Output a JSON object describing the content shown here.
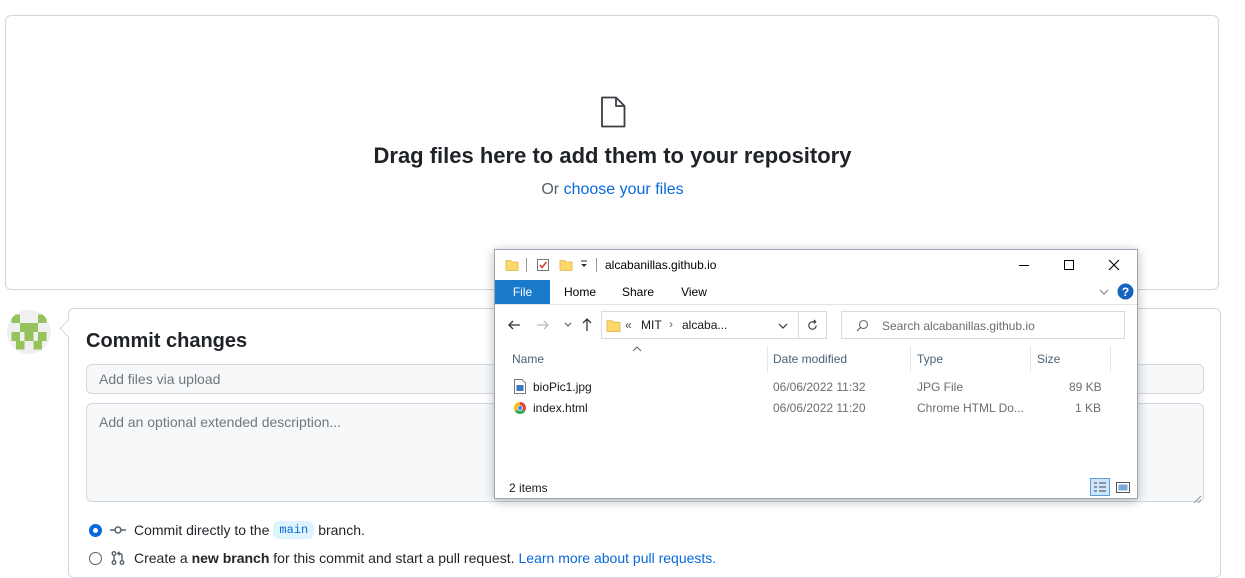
{
  "upload": {
    "drag_title": "Drag files here to add them to your repository",
    "or_text": "Or ",
    "choose_link": "choose your files"
  },
  "commit": {
    "title": "Commit changes",
    "summary_placeholder": "Add files via upload",
    "description_placeholder": "Add an optional extended description...",
    "option_direct_prefix": "Commit directly to the",
    "branch_name": "main",
    "option_direct_suffix": "branch.",
    "option_new_prefix": "Create a",
    "option_new_bold": "new branch",
    "option_new_suffix": "for this commit and start a pull request.",
    "learn_more": "Learn more about pull requests."
  },
  "explorer": {
    "title": "alcabanillas.github.io",
    "ribbon_tabs": [
      "File",
      "Home",
      "Share",
      "View"
    ],
    "breadcrumb": {
      "overflow": "«",
      "parts": [
        "MIT",
        "alcaba..."
      ]
    },
    "search_placeholder": "Search alcabanillas.github.io",
    "columns": [
      "Name",
      "Date modified",
      "Type",
      "Size"
    ],
    "files": [
      {
        "name": "bioPic1.jpg",
        "date": "06/06/2022 11:32",
        "type": "JPG File",
        "size": "89 KB",
        "icon": "jpg-file-icon"
      },
      {
        "name": "index.html",
        "date": "06/06/2022 11:20",
        "type": "Chrome HTML Do...",
        "size": "1 KB",
        "icon": "chrome-icon"
      }
    ],
    "status": "2 items"
  }
}
